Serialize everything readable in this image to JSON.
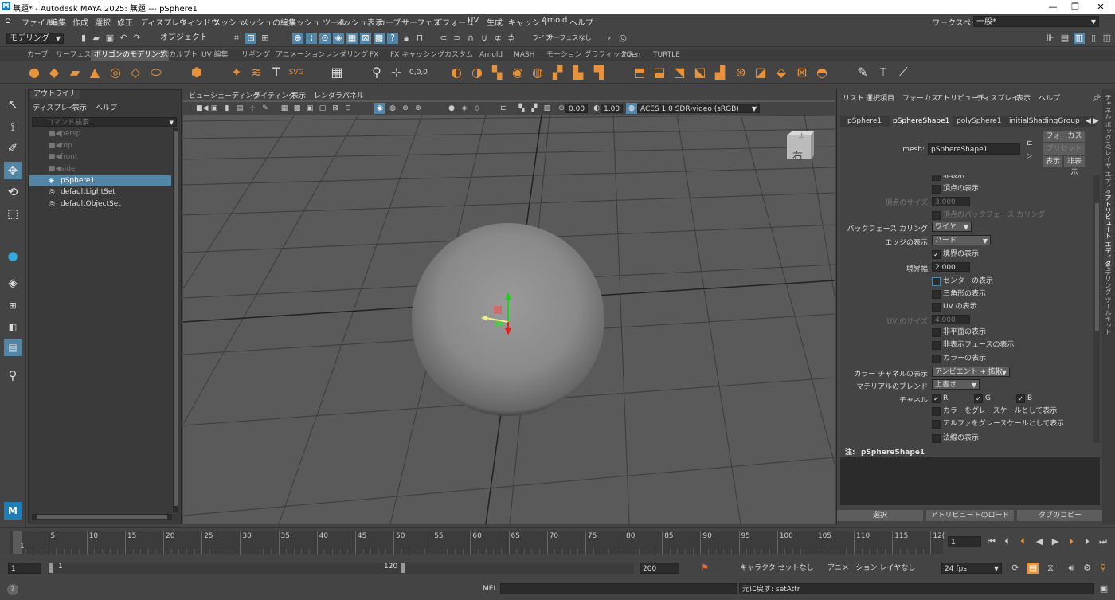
{
  "titlebar": {
    "title": "無題* - Autodesk MAYA 2025: 無題 --- pSphere1",
    "icon": "M",
    "minimize": "—",
    "maximize": "❐",
    "close": "✕"
  },
  "menus": [
    "ファイル",
    "編集",
    "作成",
    "選択",
    "修正",
    "ディスプレイ",
    "ウィンドウ",
    "メッシュ",
    "メッシュの編集",
    "メッシュ ツール",
    "メッシュ表示",
    "カーブ",
    "サーフェス",
    "デフォーム",
    "UV",
    "生成",
    "キャッシュ",
    "Arnold",
    "ヘルプ"
  ],
  "workspace": {
    "label": "ワークスペース :",
    "value": "一般*"
  },
  "statusline": {
    "mode": "モデリング",
    "object_mode": "オブジェクト",
    "live": "ライブ",
    "live_surface": "サーフェスなし"
  },
  "shelf_tabs": [
    "カーブ",
    "サーフェス",
    "ポリゴンのモデリング",
    "スカルプト",
    "UV 編集",
    "リギング",
    "アニメーション",
    "レンダリング",
    "FX",
    "FX キャッシング",
    "カスタム",
    "Arnold",
    "MASH",
    "モーション グラフィックス",
    "XGen",
    "TURTLE"
  ],
  "shelf_active": "ポリゴンのモデリング",
  "outliner": {
    "tab": "アウトライナ",
    "menu": [
      "ディスプレイ",
      "表示",
      "ヘルプ"
    ],
    "search_placeholder": "コマンド検索...",
    "items": [
      {
        "label": "persp",
        "icon": "camera-icon",
        "state": "dim"
      },
      {
        "label": "top",
        "icon": "camera-icon",
        "state": "dim"
      },
      {
        "label": "front",
        "icon": "camera-icon",
        "state": "dim"
      },
      {
        "label": "side",
        "icon": "camera-icon",
        "state": "dim"
      },
      {
        "label": "pSphere1",
        "icon": "mesh-icon",
        "state": "selected"
      },
      {
        "label": "defaultLightSet",
        "icon": "set-icon",
        "state": "normal"
      },
      {
        "label": "defaultObjectSet",
        "icon": "set-icon",
        "state": "normal"
      }
    ]
  },
  "viewport": {
    "menu": [
      "ビュー",
      "シェーディング",
      "ライティング",
      "表示",
      "レンダラ",
      "パネル"
    ],
    "exposure": "0.00",
    "gamma": "1.00",
    "colorspace": "ACES 1.0 SDR-video (sRGB)",
    "viewcube_label": "右",
    "viewcube_top": "上"
  },
  "attribute_editor": {
    "menu": [
      "リスト",
      "選択項目",
      "フォーカス",
      "アトリビュート",
      "ディスプレイ",
      "表示",
      "ヘルプ"
    ],
    "tabs": [
      "pSphere1",
      "pSphereShape1",
      "polySphere1",
      "initialShadingGroup"
    ],
    "active_tab": "pSphereShape1",
    "mesh_label": "mesh:",
    "mesh_value": "pSphereShape1",
    "focus_btn": "フォーカス",
    "preset_btn": "プリセット",
    "show_btn": "表示",
    "hide_btn": "非表示",
    "rows": {
      "r0": "非表示",
      "vertex_display": "頂点の表示",
      "vertex_size_label": "頂点のサイズ",
      "vertex_size": "3.000",
      "vertex_backface": "頂点のバックフェース カリング",
      "backface_label": "バックフェース カリング",
      "backface_value": "ワイヤ",
      "edge_label": "エッジの表示",
      "edge_value": "ハード",
      "border_display": "境界の表示",
      "border_width_label": "境界幅",
      "border_width": "2.000",
      "center_display": "センターの表示",
      "triangle_display": "三角形の表示",
      "uv_display": "UV の表示",
      "uv_size_label": "UV のサイズ",
      "uv_size": "4.000",
      "nonplanar": "非平面の表示",
      "hidden_face": "非表示フェースの表示",
      "color_display": "カラーの表示",
      "color_channel_label": "カラー チャネルの表示",
      "color_channel_value": "アンビエント + 拡散",
      "material_blend_label": "マテリアルのブレンド",
      "material_blend_value": "上書き",
      "channel_label": "チャネル",
      "ch_r": "R",
      "ch_g": "G",
      "ch_b": "B",
      "color_gray": "カラーをグレースケールとして表示",
      "alpha_gray": "アルファをグレースケールとして表示",
      "normal_display": "法線の表示"
    },
    "notes_label": "注:",
    "notes_value": "pSphereShape1",
    "bottom_buttons": [
      "選択",
      "アトリビュートのロード",
      "タブのコピー"
    ]
  },
  "side_tabs": [
    "チャネル ボックス/レイヤ エディタ",
    "アトリビュート エディタ",
    "モデリング ツールキット"
  ],
  "timeline": {
    "ticks": [
      "1",
      "5",
      "10",
      "15",
      "20",
      "25",
      "30",
      "35",
      "40",
      "45",
      "50",
      "55",
      "60",
      "65",
      "70",
      "75",
      "80",
      "85",
      "90",
      "95",
      "100",
      "105",
      "110",
      "115",
      "12("
    ],
    "current_frame": "1"
  },
  "range": {
    "start": "1",
    "inner_start": "1",
    "inner_end": "120",
    "end": "200",
    "character_set": "キャラクタ セットなし",
    "anim_layer": "アニメーション レイヤなし",
    "fps": "24 fps"
  },
  "cmdline": {
    "lang": "MEL",
    "result": "元に戻す: setAttr"
  }
}
